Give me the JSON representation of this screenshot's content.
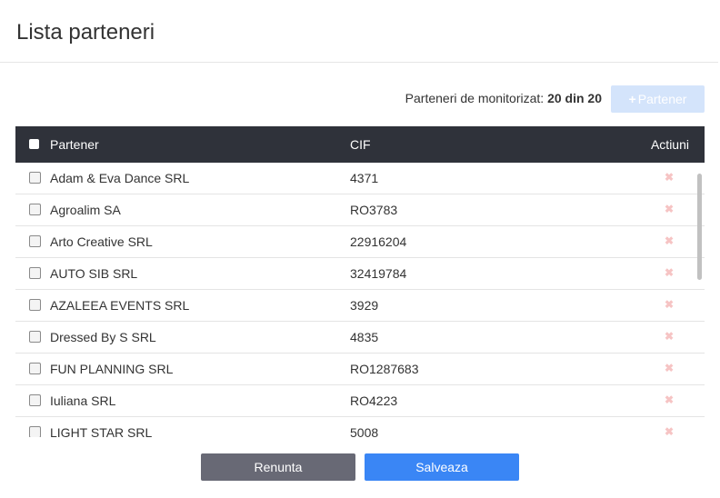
{
  "header": {
    "title": "Lista parteneri"
  },
  "toolbar": {
    "counter_label": "Parteneri de monitorizat:",
    "counter_value": "20 din 20",
    "add_button_plus": "+",
    "add_button_label": "Partener"
  },
  "table": {
    "columns": {
      "partner": "Partener",
      "cif": "CIF",
      "actions": "Actiuni"
    },
    "delete_glyph": "✖",
    "rows": [
      {
        "name": "Adam & Eva Dance SRL",
        "cif": "4371"
      },
      {
        "name": "Agroalim SA",
        "cif": "RO3783"
      },
      {
        "name": "Arto Creative SRL",
        "cif": "22916204"
      },
      {
        "name": "AUTO SIB SRL",
        "cif": "32419784"
      },
      {
        "name": "AZALEEA EVENTS SRL",
        "cif": "3929"
      },
      {
        "name": "Dressed By S SRL",
        "cif": "4835"
      },
      {
        "name": "FUN PLANNING SRL",
        "cif": "RO1287683"
      },
      {
        "name": "Iuliana SRL",
        "cif": "RO4223"
      },
      {
        "name": "LIGHT STAR SRL",
        "cif": "5008"
      }
    ]
  },
  "footer": {
    "cancel_label": "Renunta",
    "save_label": "Salveaza"
  },
  "colors": {
    "header_bg": "#2f323a",
    "primary": "#3a86f5",
    "cancel": "#686975",
    "add_disabled": "#d4e4fb",
    "delete": "#f6c4c4"
  }
}
